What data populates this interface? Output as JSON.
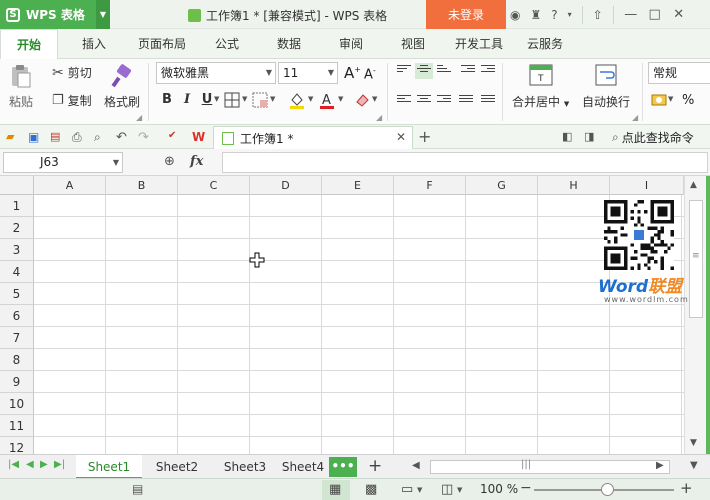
{
  "titlebar": {
    "app_logo": "S",
    "app_name": "WPS 表格",
    "doc_title": "工作簿1 * [兼容模式] - WPS 表格",
    "login": "未登录"
  },
  "tabs": [
    "开始",
    "插入",
    "页面布局",
    "公式",
    "数据",
    "审阅",
    "视图",
    "开发工具",
    "云服务"
  ],
  "ribbon": {
    "paste": "粘贴",
    "cut": "剪切",
    "copy": "复制",
    "format_painter": "格式刷",
    "font_name": "微软雅黑",
    "font_size": "11",
    "bold": "B",
    "italic": "I",
    "underline": "U",
    "merge_center": "合并居中",
    "wrap_text": "自动换行",
    "number_format": "常规",
    "percent": "%"
  },
  "quickbar": {
    "doc_tab": "工作簿1 *",
    "find_command": "点此查找命令"
  },
  "formula_bar": {
    "cell_ref": "J63",
    "fx": "fx",
    "value": ""
  },
  "grid": {
    "columns": [
      "A",
      "B",
      "C",
      "D",
      "E",
      "F",
      "G",
      "H",
      "I"
    ],
    "rows": [
      "1",
      "2",
      "3",
      "4",
      "5",
      "6",
      "7",
      "8",
      "9",
      "10",
      "11",
      "12"
    ]
  },
  "watermark": {
    "brand_word": "Word",
    "brand_cn": "联盟",
    "url": "www.wordlm.com"
  },
  "sheets": [
    "Sheet1",
    "Sheet2",
    "Sheet3",
    "Sheet4"
  ],
  "sheet_more": "•••",
  "status": {
    "zoom": "100 %"
  },
  "colors": {
    "accent_green": "#4caf50",
    "login_orange": "#f06f3d"
  }
}
